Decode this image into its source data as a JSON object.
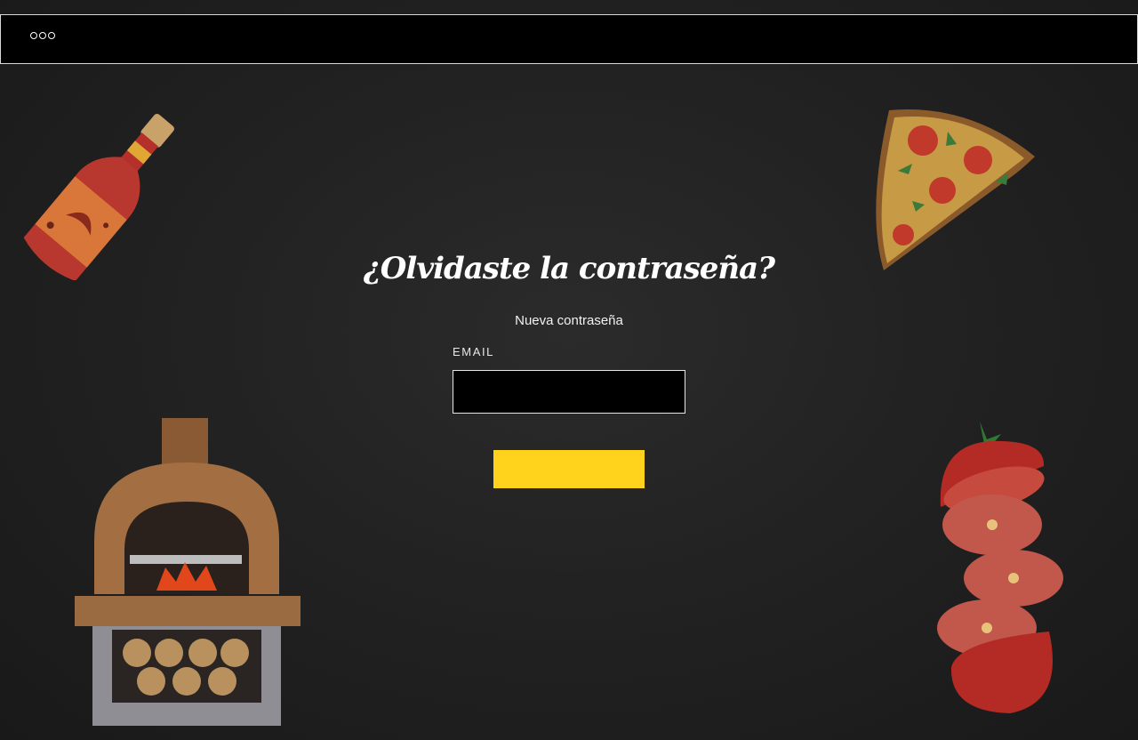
{
  "header": {
    "menu_icon": "more-dots-icon"
  },
  "main": {
    "title": "¿Olvidaste la contraseña?",
    "subtitle": "Nueva contraseña",
    "email_label": "EMAIL",
    "email_value": "",
    "submit_label": ""
  },
  "colors": {
    "background": "#1f1f1f",
    "topbar": "#000000",
    "button": "#ffd21c",
    "text": "#ffffff"
  },
  "decorations": [
    "hot-sauce-bottle",
    "pizza-slice",
    "brick-pizza-oven",
    "sliced-tomato"
  ]
}
